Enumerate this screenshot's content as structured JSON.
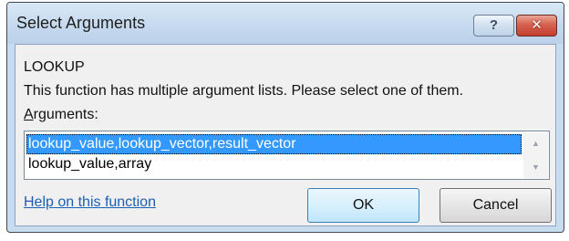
{
  "window": {
    "title": "Select Arguments",
    "help_glyph": "?",
    "close_glyph": "✕"
  },
  "dialog": {
    "function_name": "LOOKUP",
    "description": "This function has multiple argument lists.  Please select one of them.",
    "arguments_label_hotkey": "A",
    "arguments_label_rest": "rguments:",
    "options": [
      "lookup_value,lookup_vector,result_vector",
      "lookup_value,array"
    ],
    "selected_index": 0,
    "help_link": "Help on this function",
    "ok_label": "OK",
    "cancel_label": "Cancel"
  },
  "scrollbar": {
    "up_glyph": "▲",
    "down_glyph": "▼"
  },
  "colors": {
    "selection": "#3399ff",
    "link": "#1a5fb4",
    "title_bar": "#c4d8ee",
    "close_button": "#c2402d"
  }
}
